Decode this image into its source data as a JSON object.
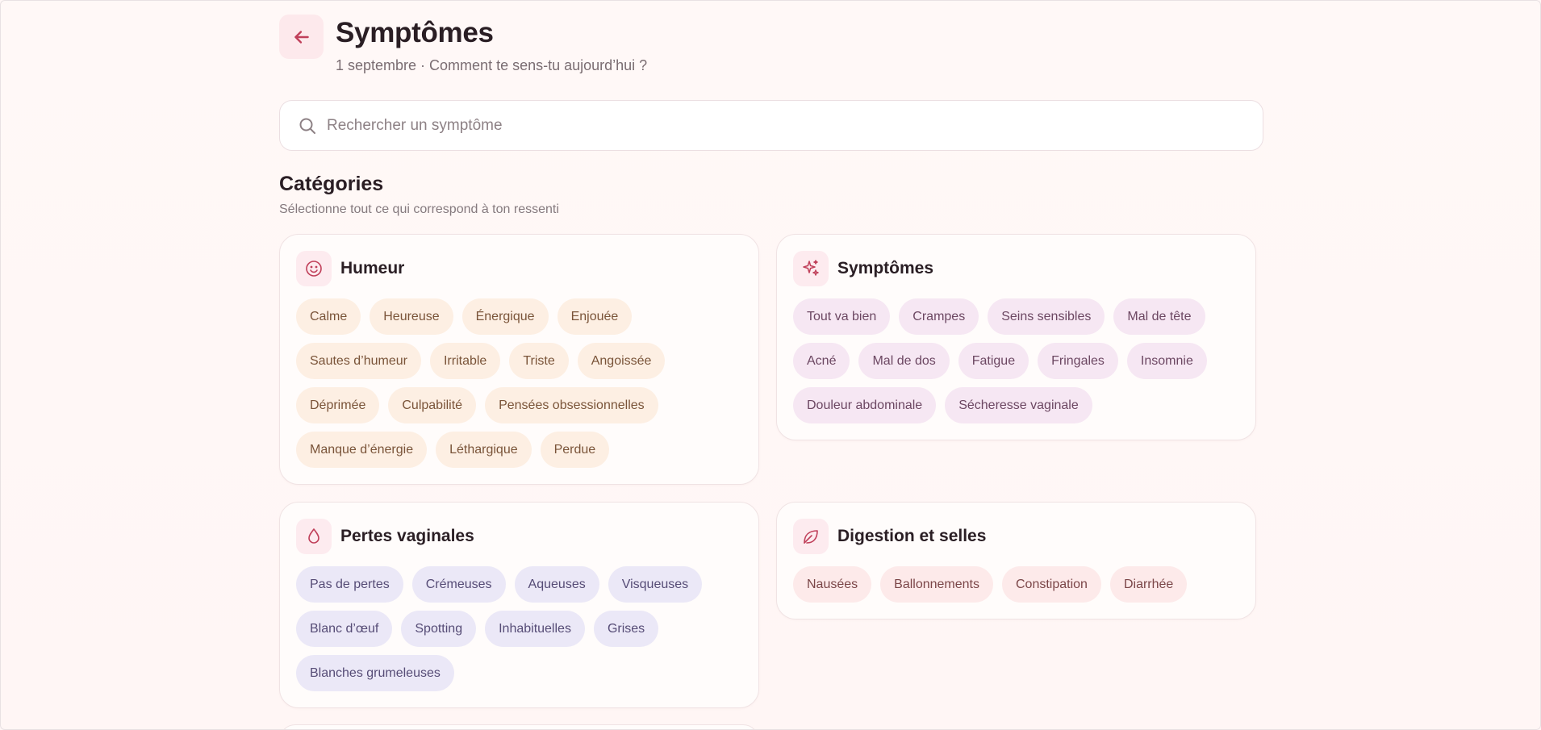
{
  "header": {
    "title": "Symptômes",
    "subtitle": "1 septembre · Comment te sens-tu aujourd’hui ?",
    "back_icon": "arrow-left-icon"
  },
  "search": {
    "placeholder": "Rechercher un symptôme",
    "value": "",
    "icon": "search-icon"
  },
  "categories": {
    "title": "Catégories",
    "subtitle": "Sélectionne tout ce qui correspond à ton ressenti"
  },
  "cards": {
    "mood": {
      "title": "Humeur",
      "icon": "smile-icon",
      "chips": [
        "Calme",
        "Heureuse",
        "Énergique",
        "Enjouée",
        "Sautes d’humeur",
        "Irritable",
        "Triste",
        "Angoissée",
        "Déprimée",
        "Culpabilité",
        "Pensées obsessionnelles",
        "Manque d’énergie",
        "Léthargique",
        "Perdue"
      ]
    },
    "symptoms": {
      "title": "Symptômes",
      "icon": "sparkles-icon",
      "chips": [
        "Tout va bien",
        "Crampes",
        "Seins sensibles",
        "Mal de tête",
        "Acné",
        "Mal de dos",
        "Fatigue",
        "Fringales",
        "Insomnie",
        "Douleur abdominale",
        "Sécheresse vaginale"
      ]
    },
    "discharge": {
      "title": "Pertes vaginales",
      "icon": "droplet-icon",
      "chips": [
        "Pas de pertes",
        "Crémeuses",
        "Aqueuses",
        "Visqueuses",
        "Blanc d’œuf",
        "Spotting",
        "Inhabituelles",
        "Grises",
        "Blanches grumeleuses"
      ]
    },
    "digestion": {
      "title": "Digestion et selles",
      "icon": "leaf-icon",
      "chips": [
        "Nausées",
        "Ballonnements",
        "Constipation",
        "Diarrhée"
      ]
    }
  },
  "colors": {
    "accent": "#c0405a",
    "background": "#fff7f6",
    "mood_chip": "#fdefe3",
    "symptom_chip": "#f6e7f3",
    "discharge_chip": "#ebe8f7",
    "digestion_chip": "#fdeaea"
  }
}
